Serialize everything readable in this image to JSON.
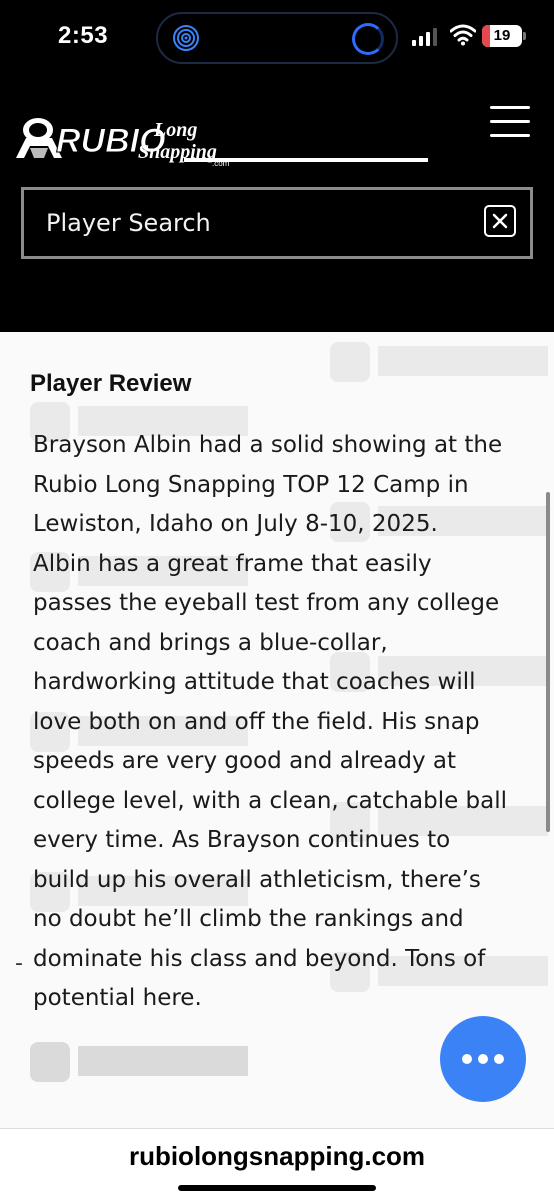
{
  "status_bar": {
    "time": "2:53",
    "battery": "19",
    "battery_level_percent": 19,
    "icons": [
      "activity-icon",
      "screen-record-icon",
      "signal-icon",
      "wifi-icon",
      "battery-icon"
    ]
  },
  "header": {
    "logo_text": "RUBIO",
    "logo_subtext_1": "Long",
    "logo_subtext_2": "Snapping",
    "logo_suffix": ".com",
    "menu_icon": "hamburger-menu-icon",
    "search_placeholder": "Player Search",
    "search_close_icon": "close-icon"
  },
  "review": {
    "title": "Player Review",
    "lines": [
      "Brayson Albin had a solid showing at the",
      "Rubio Long Snapping TOP 12 Camp in",
      "Lewiston, Idaho on July 8-10, 2025.",
      "Albin has a great frame that easily",
      "passes the eyeball test from any college",
      "coach and brings a blue-collar,",
      "hardworking attitude that coaches will",
      "love both on and off the field. His snap",
      "speeds are very good and already at",
      "college level, with a clean, catchable ball",
      "every time. As Brayson continues to",
      "build up his overall athleticism, there’s",
      "no doubt he’ll climb the rankings and",
      "dominate his class and beyond. Tons of",
      "potential here."
    ],
    "marker": "-"
  },
  "chat": {
    "icon": "more-dots-icon"
  },
  "url_bar": {
    "url": "rubiolongsnapping.com"
  },
  "colors": {
    "header_bg": "#000000",
    "chat_blue": "#3b82f6",
    "battery_red": "#e5484d"
  }
}
